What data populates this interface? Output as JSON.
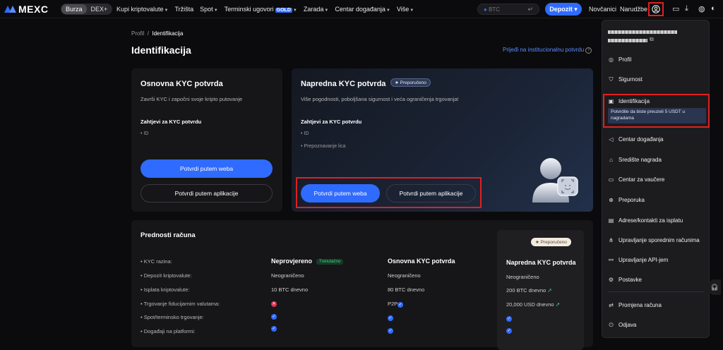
{
  "topbar": {
    "logo_text": "MEXC",
    "seg_burza": "Burza",
    "seg_dex": "DEX+",
    "nav": [
      "Kupi kriptovalute",
      "Tržišta",
      "Spot",
      "Terminski ugovori",
      "Zarada",
      "Centar događanja",
      "Više"
    ],
    "gold_badge": "GOLD",
    "search_placeholder": "BTC",
    "deposit": "Depozit",
    "wallets": "Novčanici",
    "orders": "Narudžbe"
  },
  "breadcrumb": {
    "parent": "Profil",
    "separator": "/",
    "current": "Identifikacija"
  },
  "page_title": "Identifikacija",
  "institutional_link": "Prijeđi na institucionalnu potvrdu",
  "basic_card": {
    "title": "Osnovna KYC potvrda",
    "desc": "Završi KYC i započni svoje kripto putovanje",
    "req_title": "Zahtjevi za KYC potvrdu",
    "reqs": [
      "ID"
    ],
    "btn_web": "Potvrdi putem weba",
    "btn_app": "Potvrdi putem aplikacije"
  },
  "advanced_card": {
    "title": "Napredna KYC potvrda",
    "badge": "Preporučeno",
    "desc": "Više pogodnosti, poboljšana sigurnost i veća ograničenja trgovanja!",
    "req_title": "Zahtjevi za KYC potvrdu",
    "reqs": [
      "ID",
      "Prepoznavanje lica"
    ],
    "btn_web": "Potvrdi putem weba",
    "btn_app": "Potvrdi putem aplikacije"
  },
  "benefits": {
    "title": "Prednosti računa",
    "rows": [
      "KYC razina:",
      "Depozit kriptovalute:",
      "Isplata kriptovalute:",
      "Trgovanje fiducijarnim valutama:",
      "Spot/terminsko trgovanje:",
      "Događaji na platformi:"
    ],
    "col1": {
      "head": "Neprovjereno",
      "pill": "Trenutačno",
      "deposit": "Neograničeno",
      "withdraw": "10 BTC dnevno"
    },
    "col2": {
      "head": "Osnovna KYC potvrda",
      "deposit": "Neograničeno",
      "withdraw": "80 BTC dnevno",
      "fiat": "P2P"
    },
    "col3": {
      "pill": "Preporučeno",
      "head": "Napredna KYC potvrda",
      "deposit": "Neograničeno",
      "withdraw": "200 BTC dnevno",
      "fiat": "20,000 USD dnevno"
    }
  },
  "menu": {
    "items": [
      "Profil",
      "Sigurnost",
      "Identifikacija",
      "Centar događanja",
      "Središte nagrada",
      "Centar za vaučere",
      "Preporuka",
      "Adrese/kontakti za isplatu",
      "Upravljanje sporednim računima",
      "Upravljanje API-jem",
      "Postavke",
      "Promjena računa",
      "Odjava"
    ],
    "tip": "Potvrdite da biste preuzeli 5 USDT u nagradama"
  }
}
